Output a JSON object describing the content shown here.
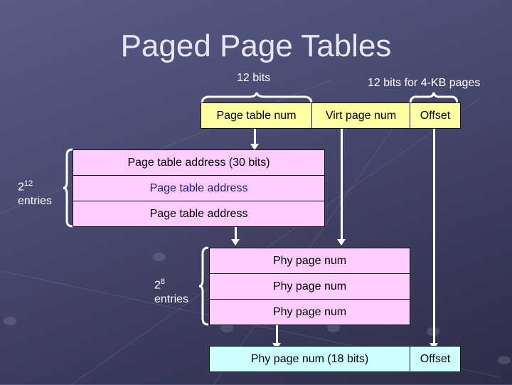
{
  "title": "Paged Page Tables",
  "virtual_address": {
    "top_label_left": "12 bits",
    "top_label_right": "12 bits for 4-KB pages",
    "fields": [
      "Page table num",
      "Virt page num",
      "Offset"
    ]
  },
  "level1_table": {
    "rows": [
      "Page table address (30 bits)",
      "Page table address",
      "Page table address"
    ],
    "entries_base": "2",
    "entries_exp": "12",
    "entries_label": "entries"
  },
  "level2_table": {
    "rows": [
      "Phy page num",
      "Phy page num",
      "Phy page num"
    ],
    "entries_base": "2",
    "entries_exp": "8",
    "entries_label": "entries"
  },
  "physical_address": {
    "fields": [
      "Phy page num (18 bits)",
      "Offset"
    ]
  },
  "colors": {
    "virtual_address_fill": "#ffffa3",
    "table_fill": "#ffccff",
    "physical_address_fill": "#ccffff",
    "highlight_text": "#1a1a8c"
  }
}
